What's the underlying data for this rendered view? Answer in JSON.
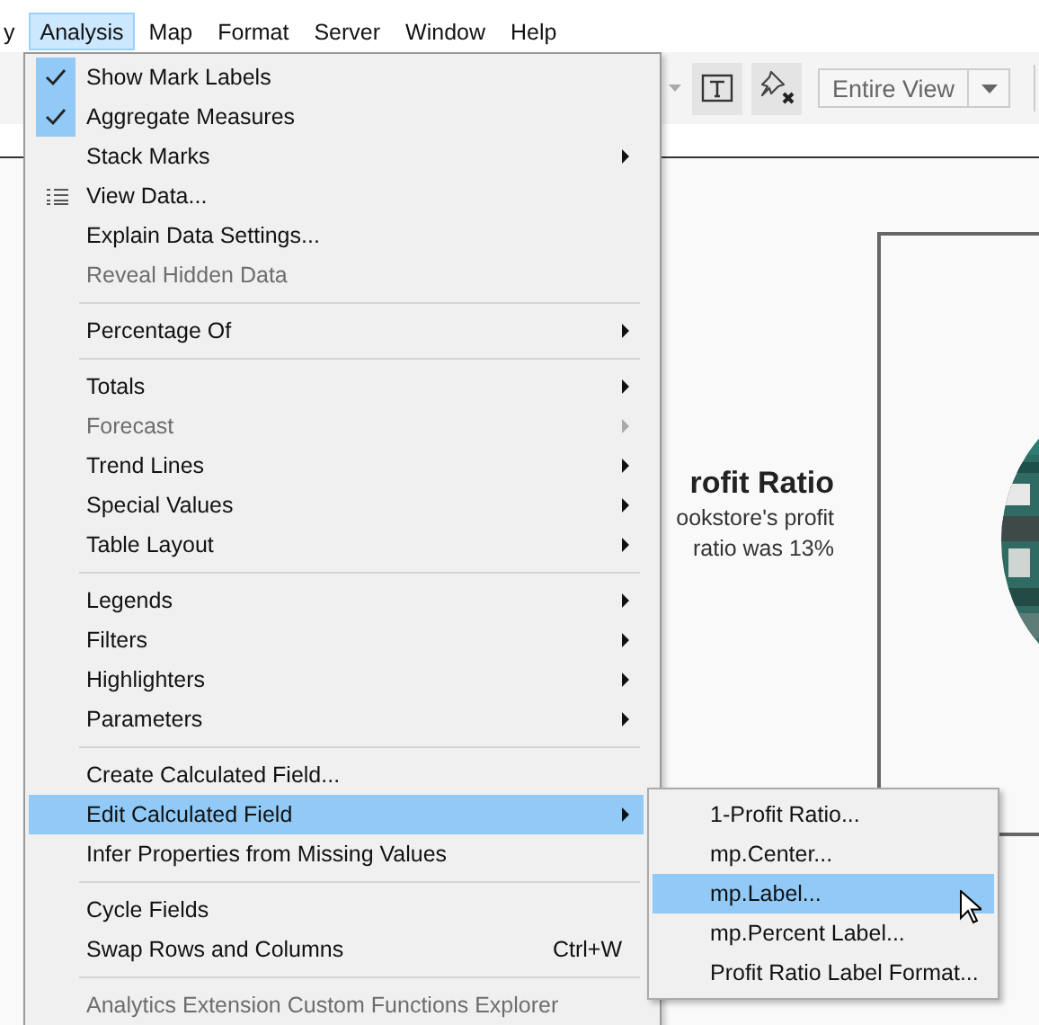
{
  "menu_bar": [
    {
      "label": "y",
      "selected": false
    },
    {
      "label": "Analysis",
      "selected": true
    },
    {
      "label": "Map",
      "selected": false
    },
    {
      "label": "Format",
      "selected": false
    },
    {
      "label": "Server",
      "selected": false
    },
    {
      "label": "Window",
      "selected": false
    },
    {
      "label": "Help",
      "selected": false
    }
  ],
  "toolbar": {
    "view_dropdown": {
      "value": "Entire View"
    }
  },
  "canvas": {
    "title": "rofit Ratio",
    "text_lines": [
      "ookstore's profit",
      "ratio was 13%"
    ]
  },
  "analysis_menu": [
    {
      "kind": "item",
      "label": "Show Mark Labels",
      "checked": true,
      "disabled": false,
      "submenu": false,
      "selected": false
    },
    {
      "kind": "item",
      "label": "Aggregate Measures",
      "checked": true,
      "disabled": false,
      "submenu": false,
      "selected": false
    },
    {
      "kind": "item",
      "label": "Stack Marks",
      "checked": false,
      "disabled": false,
      "submenu": true,
      "selected": false
    },
    {
      "kind": "icon-item",
      "label": "View Data...",
      "checked": false,
      "disabled": false,
      "submenu": false,
      "selected": false
    },
    {
      "kind": "item",
      "label": "Explain Data Settings...",
      "checked": false,
      "disabled": false,
      "submenu": false,
      "selected": false
    },
    {
      "kind": "item",
      "label": "Reveal Hidden Data",
      "checked": false,
      "disabled": true,
      "submenu": false,
      "selected": false
    },
    {
      "kind": "separator"
    },
    {
      "kind": "item",
      "label": "Percentage Of",
      "checked": false,
      "disabled": false,
      "submenu": true,
      "selected": false
    },
    {
      "kind": "separator"
    },
    {
      "kind": "item",
      "label": "Totals",
      "checked": false,
      "disabled": false,
      "submenu": true,
      "selected": false
    },
    {
      "kind": "item",
      "label": "Forecast",
      "checked": false,
      "disabled": true,
      "submenu": true,
      "selected": false
    },
    {
      "kind": "item",
      "label": "Trend Lines",
      "checked": false,
      "disabled": false,
      "submenu": true,
      "selected": false
    },
    {
      "kind": "item",
      "label": "Special Values",
      "checked": false,
      "disabled": false,
      "submenu": true,
      "selected": false
    },
    {
      "kind": "item",
      "label": "Table Layout",
      "checked": false,
      "disabled": false,
      "submenu": true,
      "selected": false
    },
    {
      "kind": "separator"
    },
    {
      "kind": "item",
      "label": "Legends",
      "checked": false,
      "disabled": false,
      "submenu": true,
      "selected": false
    },
    {
      "kind": "item",
      "label": "Filters",
      "checked": false,
      "disabled": false,
      "submenu": true,
      "selected": false
    },
    {
      "kind": "item",
      "label": "Highlighters",
      "checked": false,
      "disabled": false,
      "submenu": true,
      "selected": false
    },
    {
      "kind": "item",
      "label": "Parameters",
      "checked": false,
      "disabled": false,
      "submenu": true,
      "selected": false
    },
    {
      "kind": "separator"
    },
    {
      "kind": "item",
      "label": "Create Calculated Field...",
      "checked": false,
      "disabled": false,
      "submenu": false,
      "selected": false
    },
    {
      "kind": "item",
      "label": "Edit Calculated Field",
      "checked": false,
      "disabled": false,
      "submenu": true,
      "selected": true
    },
    {
      "kind": "item",
      "label": "Infer Properties from Missing Values",
      "checked": false,
      "disabled": false,
      "submenu": false,
      "selected": false
    },
    {
      "kind": "separator"
    },
    {
      "kind": "item",
      "label": "Cycle Fields",
      "checked": false,
      "disabled": false,
      "submenu": false,
      "selected": false
    },
    {
      "kind": "item",
      "label": "Swap Rows and Columns",
      "shortcut": "Ctrl+W",
      "checked": false,
      "disabled": false,
      "submenu": false,
      "selected": false
    },
    {
      "kind": "separator"
    },
    {
      "kind": "item",
      "label": "Analytics Extension Custom Functions Explorer",
      "checked": false,
      "disabled": true,
      "submenu": false,
      "selected": false
    }
  ],
  "calculated_field_submenu": [
    {
      "label": "1-Profit Ratio...",
      "selected": false
    },
    {
      "label": "mp.Center...",
      "selected": false
    },
    {
      "label": "mp.Label...",
      "selected": true
    },
    {
      "label": "mp.Percent Label...",
      "selected": false
    },
    {
      "label": "Profit Ratio Label Format...",
      "selected": false
    }
  ]
}
